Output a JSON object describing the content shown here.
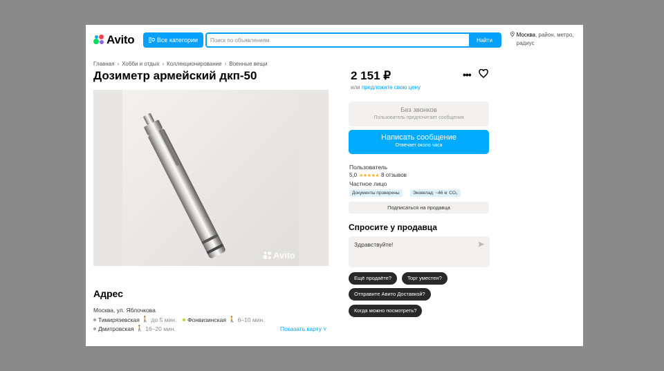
{
  "header": {
    "logo_text": "Avito",
    "categories_button": "Все категории",
    "search_placeholder": "Поиск по объявлениям",
    "search_button": "Найти",
    "location_city": "Москва",
    "location_rest": ", район, метро, радиус"
  },
  "breadcrumbs": [
    "Главная",
    "Хобби и отдых",
    "Коллекционирование",
    "Военные вещи"
  ],
  "listing": {
    "title": "Дозиметр армейский дкп-50",
    "photo_watermark": "Avito",
    "price": "2 151 ₽",
    "price_or": "или",
    "price_offer_link": "предложите свою цену"
  },
  "contact": {
    "no_calls_title": "Без звонков",
    "no_calls_sub": "Пользователь предпочитает сообщения",
    "message_title": "Написать сообщение",
    "message_sub": "Отвечает около часа"
  },
  "seller": {
    "label": "Пользователь",
    "rating": "5,0",
    "stars": "★★★★★",
    "reviews": "8 отзывов",
    "type": "Частное лицо",
    "tags": [
      "Документы проверены",
      "Эковклад: ~46 кг CO₂"
    ],
    "subscribe": "Подписаться на продавца"
  },
  "ask": {
    "heading": "Спросите у продавца",
    "input_text": "Здравствуйте!",
    "chips": [
      "Ещё продаёте?",
      "Торг уместен?",
      "Отправите Авито Доставкой?",
      "Когда можно посмотреть?"
    ]
  },
  "address": {
    "heading": "Адрес",
    "line": "Москва, ул. Яблочкова",
    "metro": [
      {
        "name": "Тимирязевская",
        "time": "до 5 мин.",
        "color": "#a0a2a3"
      },
      {
        "name": "Фонвизинская",
        "time": "6–10 мин.",
        "color": "#b1d332"
      },
      {
        "name": "Дмитровская",
        "time": "16–20 мин.",
        "color": "#a0a2a3"
      }
    ],
    "show_map": "Показать карту"
  },
  "colors": {
    "accent": "#04a0f9",
    "message_button": "#00aaff",
    "chip": "#292929",
    "stars": "#ffb021"
  }
}
